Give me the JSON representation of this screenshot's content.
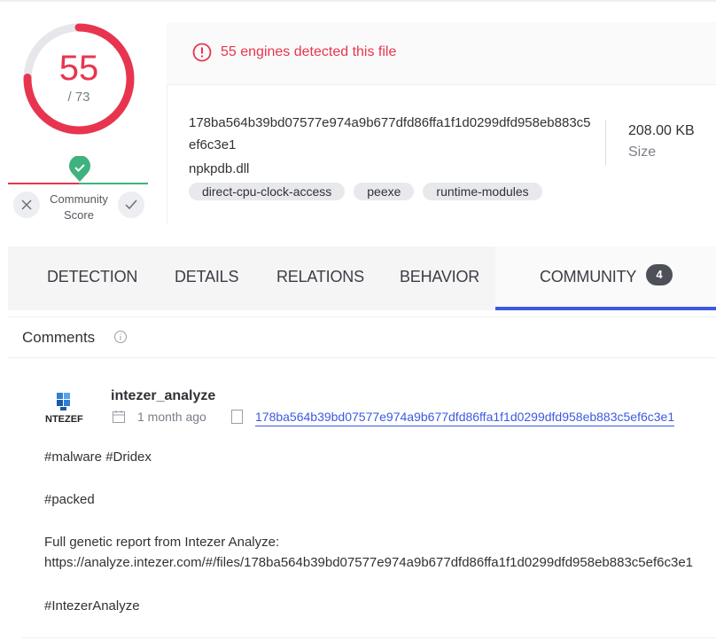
{
  "score": {
    "detections": "55",
    "total": "/ 73",
    "fraction": 0.7534,
    "color": "#e8354f"
  },
  "community_score": {
    "label_line1": "Community",
    "label_line2": "Score",
    "dislike_icon": "close-icon",
    "like_icon": "check-icon"
  },
  "detection": {
    "message": "55 engines detected this file"
  },
  "file": {
    "hash": "178ba564b39bd07577e974a9b677dfd86ffa1f1d0299dfd958eb883c5ef6c3e1",
    "name": "npkpdb.dll",
    "size_value": "208.00 KB",
    "size_label": "Size",
    "tags": [
      "direct-cpu-clock-access",
      "peexe",
      "runtime-modules"
    ]
  },
  "tabs": [
    {
      "label": "DETECTION"
    },
    {
      "label": "DETAILS"
    },
    {
      "label": "RELATIONS"
    },
    {
      "label": "BEHAVIOR"
    },
    {
      "label": "COMMUNITY",
      "badge": "4",
      "active": true
    }
  ],
  "comments": {
    "title": "Comments",
    "items": [
      {
        "avatar_text": "INTEZER",
        "author": "intezer_analyze",
        "time": "1 month ago",
        "file_link": "178ba564b39bd07577e974a9b677dfd86ffa1f1d0299dfd958eb883c5ef6c3e1",
        "lines": [
          "#malware #Dridex",
          "#packed",
          "Full genetic report from Intezer Analyze:",
          "https://analyze.intezer.com/#/files/178ba564b39bd07577e974a9b677dfd86ffa1f1d0299dfd958eb883c5ef6c3e1",
          "#IntezerAnalyze"
        ]
      }
    ]
  },
  "colors": {
    "accent_red": "#e8354f",
    "accent_blue": "#3c5ae0",
    "community_green": "#3fb37f"
  }
}
